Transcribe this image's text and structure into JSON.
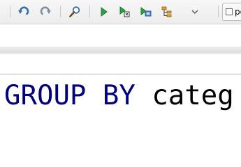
{
  "toolbar": {
    "buttons": [
      {
        "name": "undo-icon"
      },
      {
        "name": "redo-icon"
      },
      {
        "name": "search-icon"
      },
      {
        "name": "run-icon"
      },
      {
        "name": "run-selection-icon"
      },
      {
        "name": "run-script-icon"
      },
      {
        "name": "explain-plan-icon"
      },
      {
        "name": "chevron-down-icon"
      }
    ],
    "colors": {
      "undo": "#2f6fb6",
      "run": "#2ea043",
      "run_dark": "#1e7a33"
    }
  },
  "perspective": {
    "label": "pc"
  },
  "editor": {
    "keyword": "GROUP BY",
    "space": " ",
    "identifier": "categ",
    "keyword_color": "#00007f",
    "identifier_color": "#000000"
  }
}
